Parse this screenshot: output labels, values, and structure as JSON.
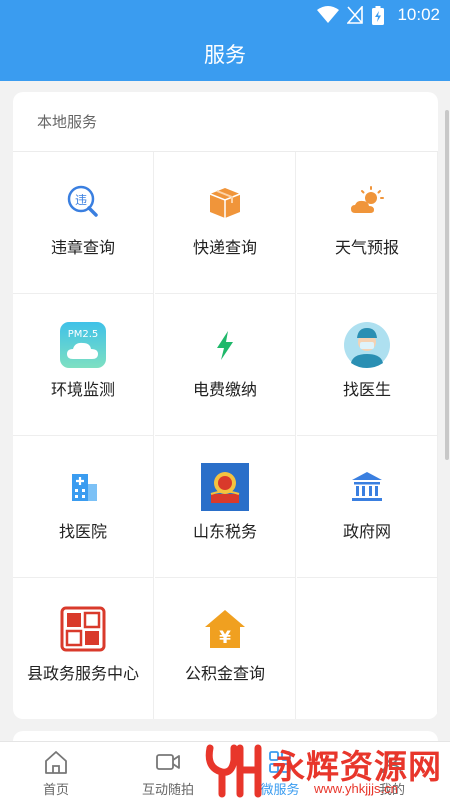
{
  "status_bar": {
    "time": "10:02"
  },
  "title": "服务",
  "section": {
    "title": "本地服务",
    "items": [
      {
        "label": "违章查询",
        "icon": "violation-search-icon"
      },
      {
        "label": "快递查询",
        "icon": "package-icon"
      },
      {
        "label": "天气预报",
        "icon": "weather-icon"
      },
      {
        "label": "环境监测",
        "icon": "pm25-cloud-icon",
        "icon_text": "PM2.5"
      },
      {
        "label": "电费缴纳",
        "icon": "lightning-icon"
      },
      {
        "label": "找医生",
        "icon": "doctor-icon"
      },
      {
        "label": "找医院",
        "icon": "hospital-icon"
      },
      {
        "label": "山东税务",
        "icon": "tax-emblem-icon"
      },
      {
        "label": "政府网",
        "icon": "government-building-icon"
      },
      {
        "label": "县政务服务中心",
        "icon": "seal-stamp-icon"
      },
      {
        "label": "公积金查询",
        "icon": "housing-fund-icon",
        "icon_text": "¥"
      }
    ]
  },
  "tabs": [
    {
      "label": "首页",
      "icon": "home-icon"
    },
    {
      "label": "互动随拍",
      "icon": "video-camera-icon"
    },
    {
      "label": "微服务",
      "icon": "services-icon",
      "active": true
    },
    {
      "label": "我的",
      "icon": "profile-icon"
    }
  ],
  "watermark": {
    "brand": "永辉资源网",
    "url": "www.yhkjjjs.cn"
  },
  "colors": {
    "primary": "#3a9cf0",
    "orange": "#f0953a",
    "green": "#1fb86a",
    "watermark_red": "#e8362b"
  }
}
